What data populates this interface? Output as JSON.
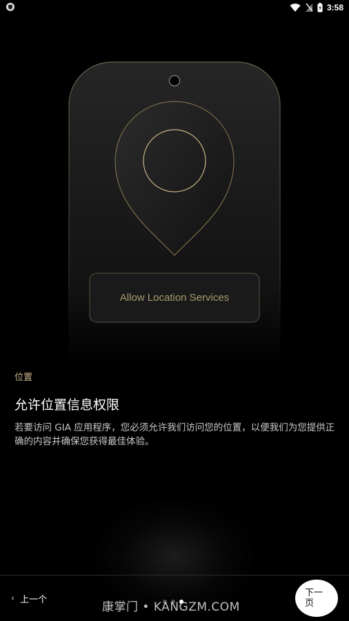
{
  "status_bar": {
    "time": "3:58",
    "left_icon": "shield-icon",
    "right_icons": [
      "wifi-icon",
      "signal-icon",
      "battery-icon"
    ]
  },
  "illustration": {
    "button_text": "Allow Location Services",
    "icon": "location-pin-icon",
    "accent_color": "#c9b48a"
  },
  "content": {
    "section_label": "位置",
    "title": "允许位置信息权限",
    "description": "若要访问 GIA 应用程序，您必须允许我们访问您的位置，以便我们为您提供正确的内容并确保您获得最佳体验。"
  },
  "navigation": {
    "prev_label": "上一个",
    "next_label_line1": "下一",
    "next_label_line2": "页",
    "chevron": "‹"
  },
  "watermark": "康掌门 • KANGZM.COM"
}
